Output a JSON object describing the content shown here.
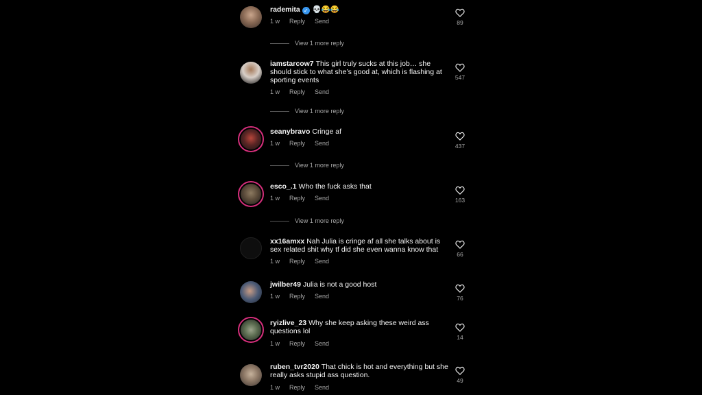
{
  "comments": [
    {
      "username": "rademita",
      "verified": true,
      "text": "💀😂😂",
      "age": "1 w",
      "reply": "Reply",
      "send": "Send",
      "likes": "89",
      "more_replies": "View 1 more reply"
    },
    {
      "username": "iamstarcow7",
      "verified": false,
      "text": "This girl truly sucks at this job… she should stick to what she’s good at, which is flashing at sporting events",
      "age": "1 w",
      "reply": "Reply",
      "send": "Send",
      "likes": "547",
      "more_replies": "View 1 more reply"
    },
    {
      "username": "seanybravo",
      "verified": false,
      "text": "Cringe af",
      "age": "1 w",
      "reply": "Reply",
      "send": "Send",
      "likes": "437",
      "more_replies": "View 1 more reply"
    },
    {
      "username": "esco_.1",
      "verified": false,
      "text": "Who the fuck asks that",
      "age": "1 w",
      "reply": "Reply",
      "send": "Send",
      "likes": "163",
      "more_replies": "View 1 more reply"
    },
    {
      "username": "xx16amxx",
      "verified": false,
      "text": "Nah Julia is cringe af all she talks about is sex related shit why tf did she even wanna know that",
      "age": "1 w",
      "reply": "Reply",
      "send": "Send",
      "likes": "66"
    },
    {
      "username": "jwilber49",
      "verified": false,
      "text": "Julia is not a good host",
      "age": "1 w",
      "reply": "Reply",
      "send": "Send",
      "likes": "76"
    },
    {
      "username": "ryizlive_23",
      "verified": false,
      "text": "Why she keep asking these weird ass questions lol",
      "age": "1 w",
      "reply": "Reply",
      "send": "Send",
      "likes": "14"
    },
    {
      "username": "ruben_tvr2020",
      "verified": false,
      "text": "That chick is hot and everything but she really asks stupid ass question.",
      "age": "1 w",
      "reply": "Reply",
      "send": "Send",
      "likes": "49"
    }
  ],
  "icons": {
    "like": "heart-outline-icon",
    "verified": "verified-badge-icon"
  },
  "colors": {
    "background": "#000000",
    "text": "#f5f5f5",
    "muted": "#a8a8a8",
    "story_ring": "#d62f7c",
    "verified": "#3897f0"
  }
}
